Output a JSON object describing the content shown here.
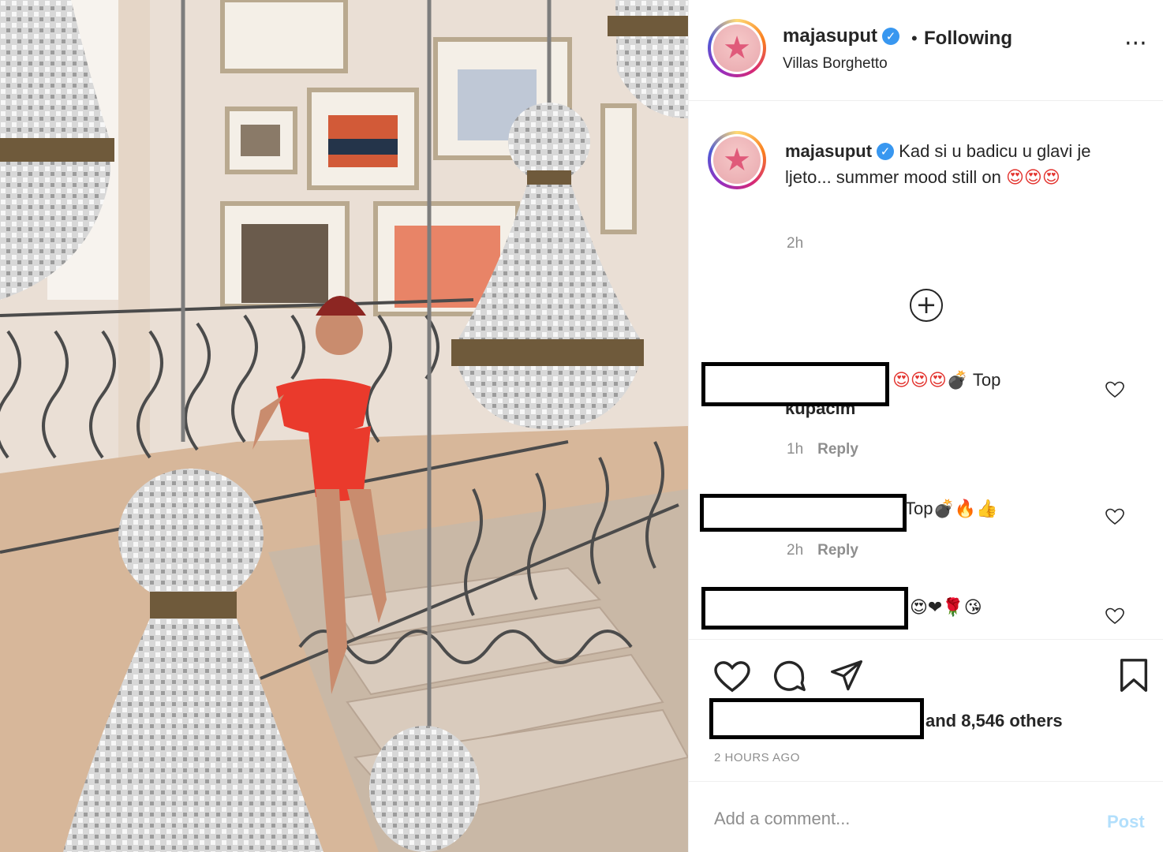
{
  "post": {
    "username": "majasuput",
    "following_label": "Following",
    "location": "Villas Borghetto",
    "caption": "Kad si u badicu u glavi je ljeto... summer mood still on",
    "caption_emojis": "😍😍😍",
    "caption_time": "2h"
  },
  "comments": [
    {
      "text": "Top",
      "text_prefix_emojis": "😍😍😍💣",
      "text_cut": "kupacim",
      "time": "1h",
      "reply_label": "Reply"
    },
    {
      "text": "Top",
      "text_suffix_emojis": "💣🔥👍",
      "time": "2h",
      "reply_label": "Reply"
    },
    {
      "text_emojis": "😍❤🌹😘"
    }
  ],
  "likes": {
    "others_text": "and 8,546 others"
  },
  "timestamp": "2 HOURS AGO",
  "add_comment": {
    "placeholder": "Add a comment...",
    "post_label": "Post"
  },
  "icons": {
    "more": "more-options-icon",
    "verified": "verified-badge-icon",
    "load_more": "plus-circle-icon",
    "like": "heart-icon",
    "comment": "comment-icon",
    "share": "share-icon",
    "save": "bookmark-icon"
  },
  "colors": {
    "verified": "#3897f0",
    "text": "#262626",
    "muted": "#8e8e8e",
    "post_button": "#b2dffc"
  }
}
